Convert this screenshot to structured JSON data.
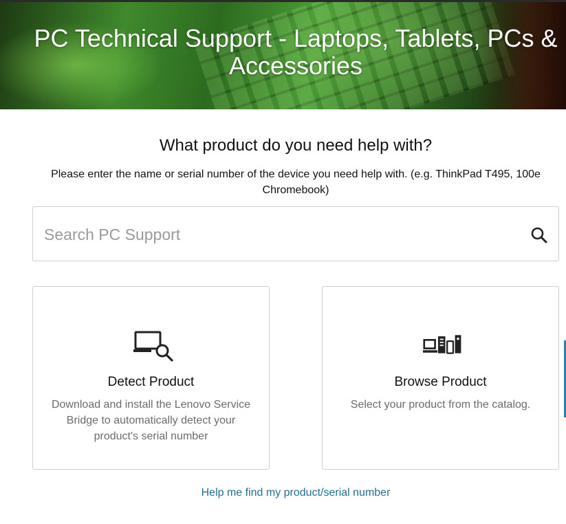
{
  "hero": {
    "title": "PC Technical Support - Laptops, Tablets, PCs & Accessories"
  },
  "main": {
    "question": "What product do you need help with?",
    "instructions": "Please enter the name or serial number of the device you need help with. (e.g. ThinkPad T495, 100e Chromebook)"
  },
  "search": {
    "placeholder": "Search PC Support",
    "value": "",
    "icon": "search-icon"
  },
  "cards": [
    {
      "icon": "laptop-search-icon",
      "title": "Detect Product",
      "description": "Download and install the Lenovo Service Bridge to automatically detect your product's serial number"
    },
    {
      "icon": "devices-catalog-icon",
      "title": "Browse Product",
      "description": "Select your product from the catalog."
    }
  ],
  "links": {
    "help": "Help me find my product/serial number"
  },
  "colors": {
    "link": "#1f6f93",
    "hero_green": "#3f8a2c",
    "text_muted": "#6b6b6b",
    "border": "#cfcfcf"
  }
}
